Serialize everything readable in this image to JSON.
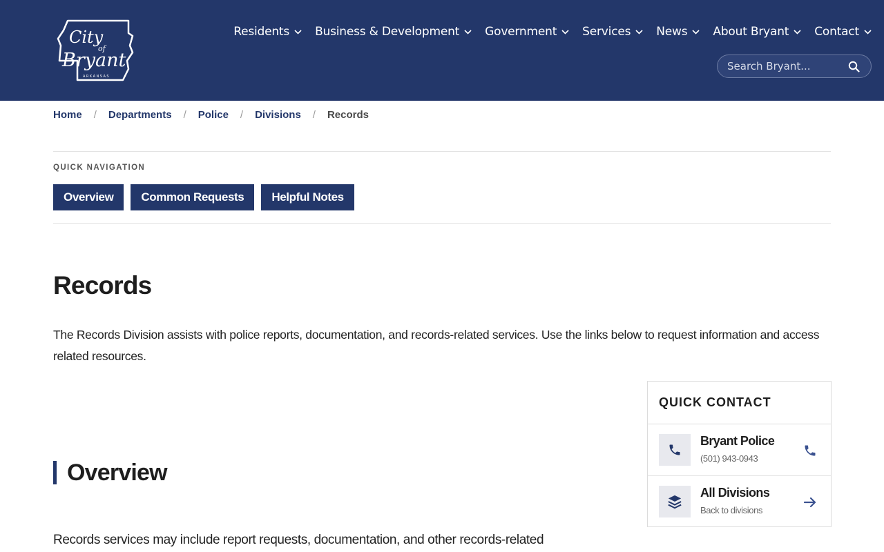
{
  "header": {
    "logo_alt": "City of Bryant Arkansas",
    "nav": [
      {
        "label": "Residents"
      },
      {
        "label": "Business & Development"
      },
      {
        "label": "Government"
      },
      {
        "label": "Services"
      },
      {
        "label": "News"
      },
      {
        "label": "About Bryant"
      },
      {
        "label": "Contact"
      }
    ],
    "search": {
      "placeholder": "Search Bryant..."
    }
  },
  "breadcrumb": [
    "Home",
    "Departments",
    "Police",
    "Divisions",
    "Records"
  ],
  "quick_navigation": {
    "label": "QUICK NAVIGATION",
    "buttons": [
      "Overview",
      "Common Requests",
      "Helpful Notes"
    ]
  },
  "main": {
    "title": "Records",
    "intro": "The Records Division assists with police reports, documentation, and records-related services. Use the links below to request information and access related resources.",
    "overview_title": "Overview",
    "overview_text": "Records services may include report requests, documentation, and other records-related"
  },
  "quick_contact": {
    "title": "QUICK CONTACT",
    "items": [
      {
        "title": "Bryant Police",
        "sub": "(501) 943-0943",
        "icon": "phone-icon",
        "action_icon": "phone-icon"
      },
      {
        "title": "All Divisions",
        "sub": "Back to divisions",
        "icon": "layers-icon",
        "action_icon": "arrow-right-icon"
      }
    ]
  },
  "colors": {
    "brand_navy": "#23376a",
    "text": "#1e1e1e",
    "border": "#dcdcdc"
  }
}
